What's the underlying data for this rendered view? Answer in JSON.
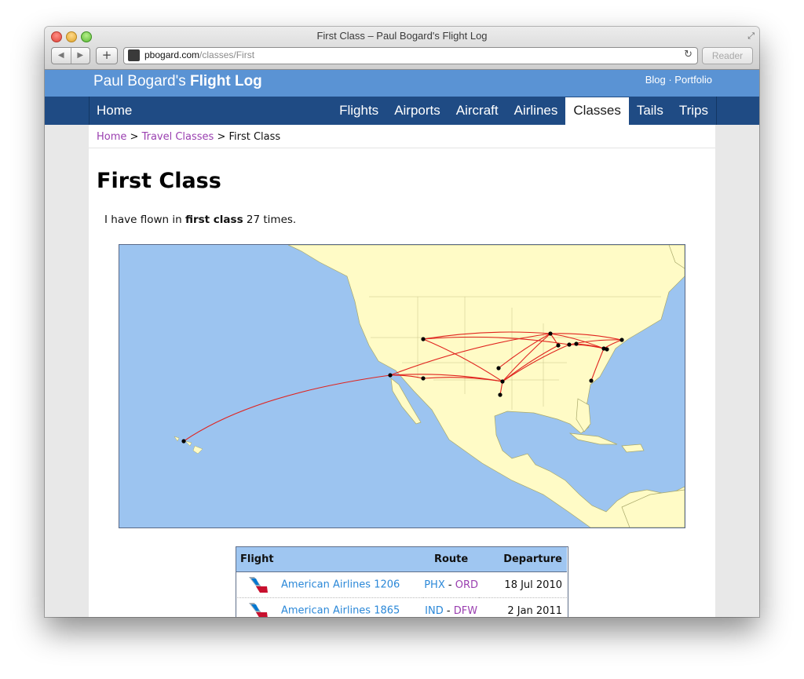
{
  "window": {
    "title": "First Class – Paul Bogard's Flight Log",
    "url_host": "pbogard.com",
    "url_path": "/classes/First",
    "reader_label": "Reader"
  },
  "site": {
    "name_light": "Paul Bogard's",
    "name_bold": "Flight Log",
    "top_links": [
      "Blog",
      "Portfolio"
    ],
    "top_link_separator": " · "
  },
  "nav": {
    "home": "Home",
    "items": [
      {
        "label": "Flights",
        "active": false
      },
      {
        "label": "Airports",
        "active": false
      },
      {
        "label": "Aircraft",
        "active": false
      },
      {
        "label": "Airlines",
        "active": false
      },
      {
        "label": "Classes",
        "active": true
      },
      {
        "label": "Tails",
        "active": false
      },
      {
        "label": "Trips",
        "active": false
      }
    ]
  },
  "breadcrumb": {
    "items": [
      "Home",
      "Travel Classes",
      "First Class"
    ],
    "separator": " > "
  },
  "page": {
    "title": "First Class",
    "intro_prefix": "I have flown in ",
    "intro_bold": "first class",
    "intro_suffix": " 27 times."
  },
  "table": {
    "headers": [
      "Flight",
      "Route",
      "Departure"
    ],
    "rows": [
      {
        "airline_icon": "american-airlines-logo-icon",
        "flight": "American Airlines 1206",
        "from": "PHX",
        "to": "ORD",
        "date": "18 Jul 2010"
      },
      {
        "airline_icon": "american-airlines-logo-icon",
        "flight": "American Airlines 1865",
        "from": "IND",
        "to": "DFW",
        "date": "2 Jan 2011"
      }
    ]
  },
  "colors": {
    "header_blue": "#5a93d4",
    "nav_navy": "#1f4b84",
    "visited_link": "#9a3fb0",
    "link_blue": "#2b88d8",
    "route_red": "#e0231e",
    "ocean": "#9cc4f0",
    "land": "#fffbc6"
  }
}
